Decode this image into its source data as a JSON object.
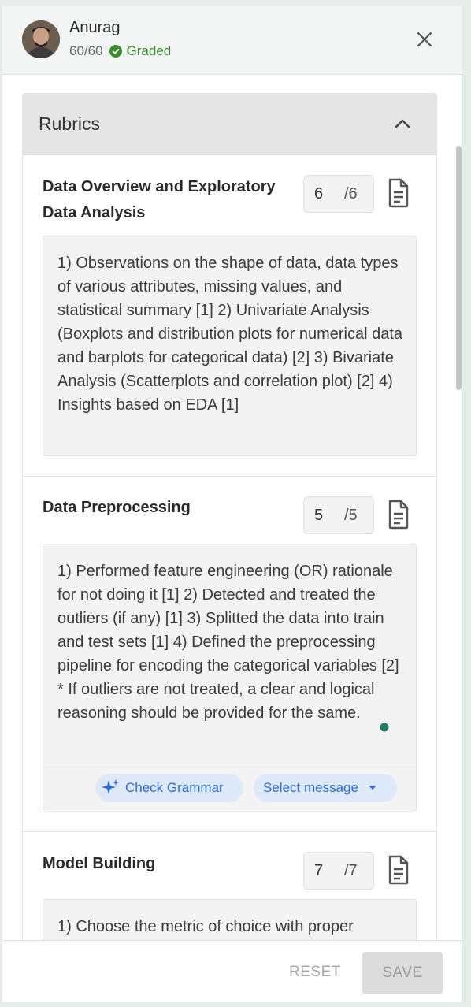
{
  "header": {
    "name": "Anurag",
    "score": "60/60",
    "status": "Graded"
  },
  "card": {
    "title": "Rubrics"
  },
  "sections": [
    {
      "title": "Data Overview and Exploratory Data Analysis",
      "mark": "6",
      "max": "/6",
      "description": "1) Observations on the shape of data, data types of various attributes, missing values, and statistical summary [1] 2) Univariate Analysis (Boxplots and distribution plots for numerical data and barplots for categorical data) [2] 3) Bivariate Analysis (Scatterplots and correlation plot) [2] 4) Insights based on EDA [1]"
    },
    {
      "title": "Data Preprocessing",
      "mark": "5",
      "max": "/5",
      "description": "1) Performed feature engineering (OR) rationale for not doing it [1] 2) Detected and treated the outliers (if any) [1] 3) Splitted the data into train and test sets [1] 4) Defined the preprocessing pipeline for encoding the categorical variables [2] * If outliers are not treated, a clear and logical reasoning should be provided for the same."
    },
    {
      "title": "Model Building",
      "mark": "7",
      "max": "/7",
      "description": "1) Choose the metric of choice with proper"
    }
  ],
  "tools": {
    "grammar_label": "Check Grammar",
    "select_label": "Select message"
  },
  "footer": {
    "reset_label": "RESET",
    "save_label": "SAVE"
  },
  "colors": {
    "accent": "#2f6bd1",
    "graded": "#3a8a2e",
    "panel_bg": "#f3f3f3"
  }
}
